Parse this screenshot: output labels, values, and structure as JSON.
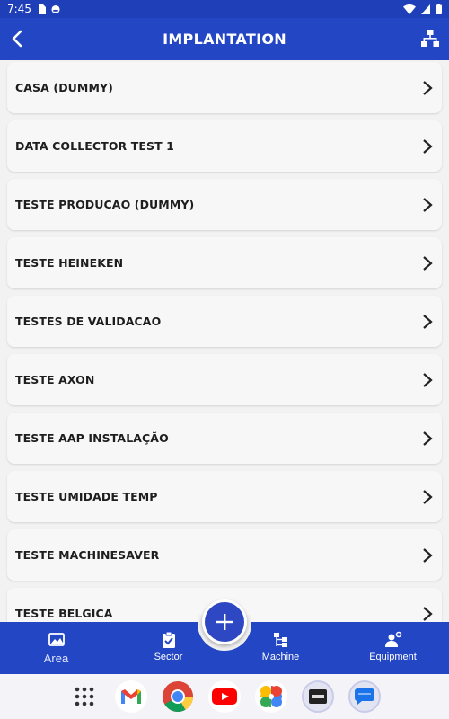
{
  "status_bar": {
    "time": "7:45"
  },
  "app_bar": {
    "title": "IMPLANTATION"
  },
  "list": {
    "items": [
      {
        "label": "CASA (DUMMY)"
      },
      {
        "label": "DATA COLLECTOR TEST 1"
      },
      {
        "label": "TESTE PRODUCAO (DUMMY)"
      },
      {
        "label": "TESTE HEINEKEN"
      },
      {
        "label": "TESTES DE VALIDACAO"
      },
      {
        "label": "TESTE AXON"
      },
      {
        "label": "TESTE AAP INSTALAÇÃO"
      },
      {
        "label": "TESTE UMIDADE TEMP"
      },
      {
        "label": "TESTE MACHINESAVER"
      },
      {
        "label": "TESTE BELGICA"
      }
    ]
  },
  "bottom_nav": {
    "items": [
      {
        "label": "Area",
        "icon": "image-icon",
        "active": true
      },
      {
        "label": "Sector",
        "icon": "clipboard-check-icon"
      },
      {
        "label": "Machine",
        "icon": "hierarchy-icon"
      },
      {
        "label": "Equipment",
        "icon": "engineer-icon"
      }
    ]
  },
  "fab": {
    "icon": "plus-icon"
  },
  "dock": {
    "apps": [
      "app-drawer-icon",
      "gmail-icon",
      "chrome-icon",
      "youtube-icon",
      "photos-icon",
      "app-icon",
      "messages-icon"
    ]
  },
  "colors": {
    "primary": "#2346c4",
    "status_bar": "#1f3fb8",
    "background": "#f2f2f2"
  }
}
